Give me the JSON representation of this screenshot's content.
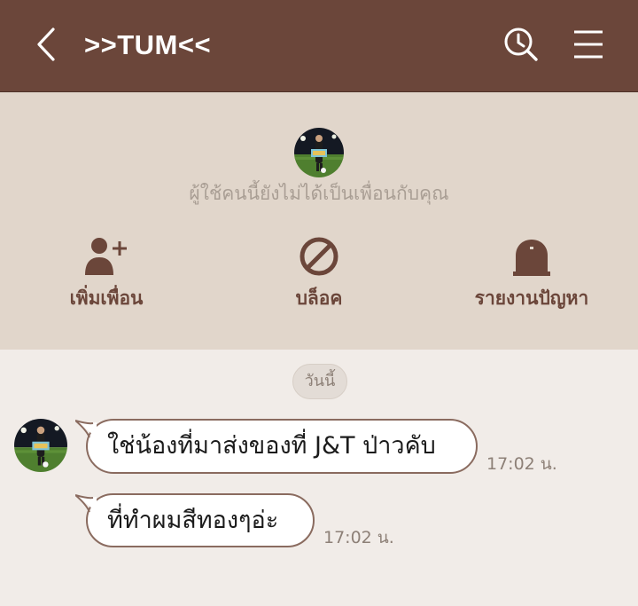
{
  "header": {
    "title": ">>TUM<<",
    "back_icon": "chevron-left-icon",
    "search_icon": "clock-search-icon",
    "menu_icon": "hamburger-menu-icon",
    "background_color": "#6b463a"
  },
  "notice": {
    "text": "ผู้ใช้คนนี้ยังไม่ได้เป็นเพื่อนกับคุณ",
    "actions": [
      {
        "label": "เพิ่มเพื่อน",
        "icon": "add-friend-icon"
      },
      {
        "label": "บล็อค",
        "icon": "block-icon"
      },
      {
        "label": "รายงานปัญหา",
        "icon": "report-icon"
      }
    ]
  },
  "chat": {
    "date_label": "วันนี้",
    "messages": [
      {
        "text": "ใช่น้องที่มาส่งของที่ J&T ป่าวคับ",
        "time": "17:02 น."
      },
      {
        "text": "ที่ทำผมสีทองๆอ่ะ",
        "time": "17:02 น."
      }
    ]
  }
}
